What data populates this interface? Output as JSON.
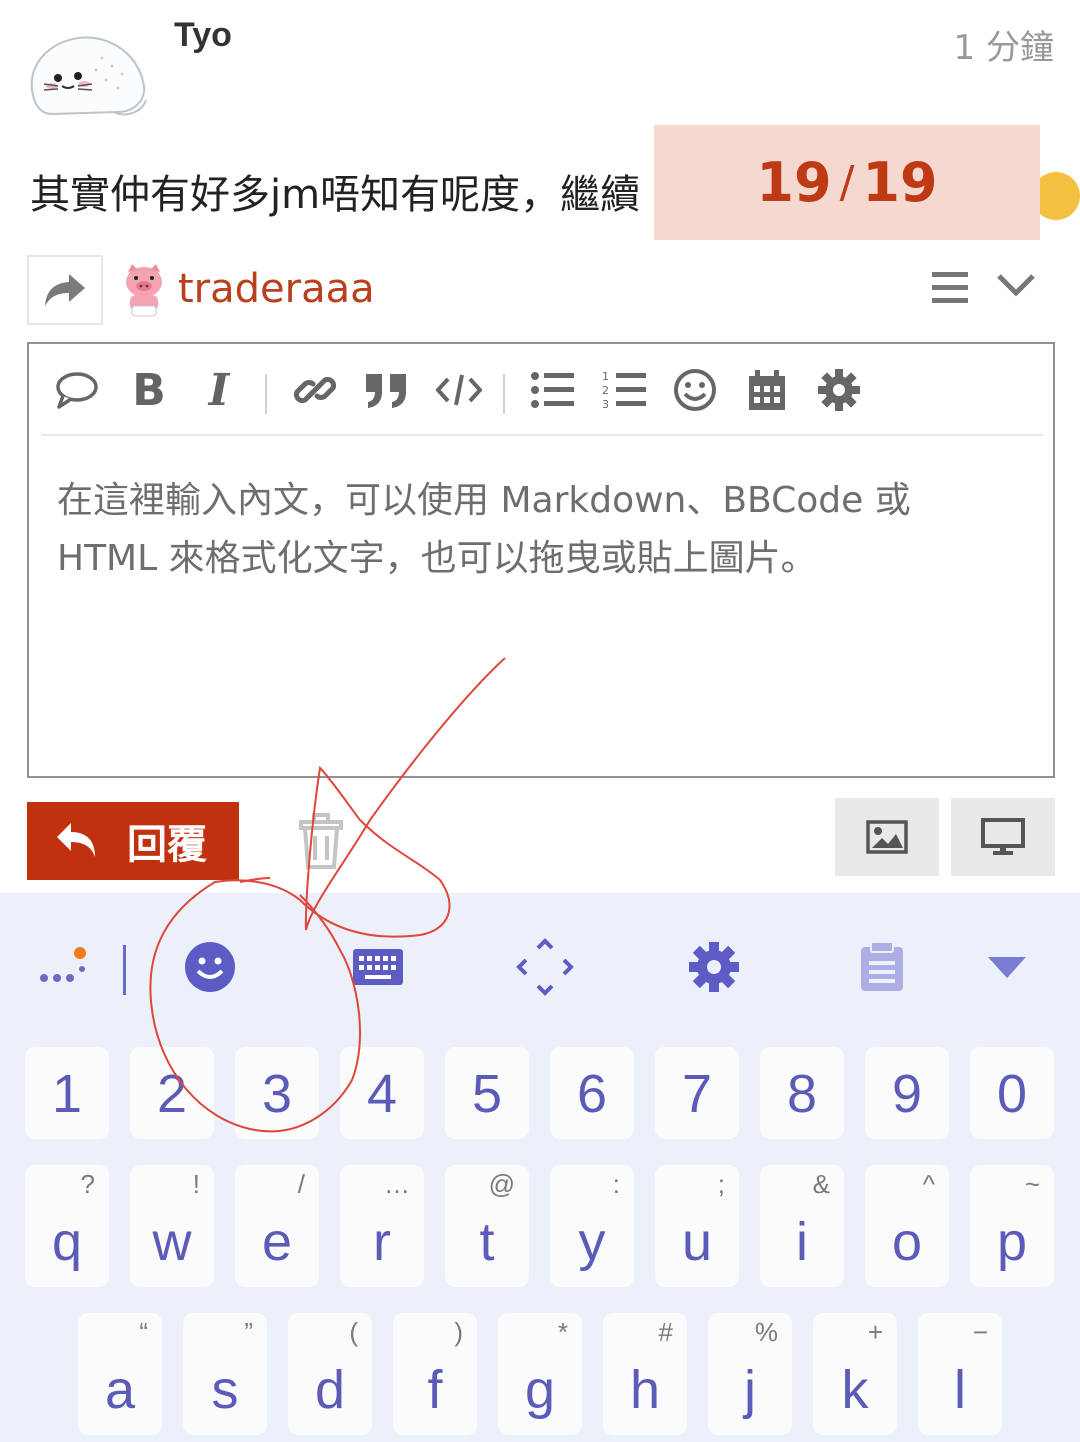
{
  "post": {
    "username": "Tyo",
    "time": "1 分鐘",
    "text": "其實仲有好多jm唔知有呢度，繼續",
    "avatar_icon": "seal-icon"
  },
  "progress": {
    "current": "19",
    "separator": "/",
    "total": "19"
  },
  "composer": {
    "reply_to_user": "traderaaa",
    "reply_to_avatar_icon": "pig-icon",
    "toolbar_icons": [
      "quote-icon",
      "bold-icon",
      "italic-icon",
      "link-icon",
      "blockquote-icon",
      "code-icon",
      "bullet-list-icon",
      "numbered-list-icon",
      "emoji-icon",
      "calendar-icon",
      "gear-icon"
    ],
    "toolbar_bold": "B",
    "toolbar_italic": "I",
    "placeholder": "在這裡輸入內文，可以使用 Markdown、BBCode 或 HTML 來格式化文字，也可以拖曳或貼上圖片。",
    "reply_label": "回覆",
    "accent_color": "#c2310f"
  },
  "keyboard": {
    "numbers": [
      "1",
      "2",
      "3",
      "4",
      "5",
      "6",
      "7",
      "8",
      "9",
      "0"
    ],
    "row1": [
      {
        "key": "q",
        "hint": "?"
      },
      {
        "key": "w",
        "hint": "!"
      },
      {
        "key": "e",
        "hint": "/"
      },
      {
        "key": "r",
        "hint": "…"
      },
      {
        "key": "t",
        "hint": "@"
      },
      {
        "key": "y",
        "hint": ":"
      },
      {
        "key": "u",
        "hint": ";"
      },
      {
        "key": "i",
        "hint": "&"
      },
      {
        "key": "o",
        "hint": "^"
      },
      {
        "key": "p",
        "hint": "~"
      }
    ],
    "row2": [
      {
        "key": "a",
        "hint": "“"
      },
      {
        "key": "s",
        "hint": "”"
      },
      {
        "key": "d",
        "hint": "("
      },
      {
        "key": "f",
        "hint": ")"
      },
      {
        "key": "g",
        "hint": "*"
      },
      {
        "key": "h",
        "hint": "#"
      },
      {
        "key": "j",
        "hint": "%"
      },
      {
        "key": "k",
        "hint": "+"
      },
      {
        "key": "l",
        "hint": "−"
      }
    ],
    "key_color": "#5b5bb8",
    "background": "#ecf0fb"
  }
}
